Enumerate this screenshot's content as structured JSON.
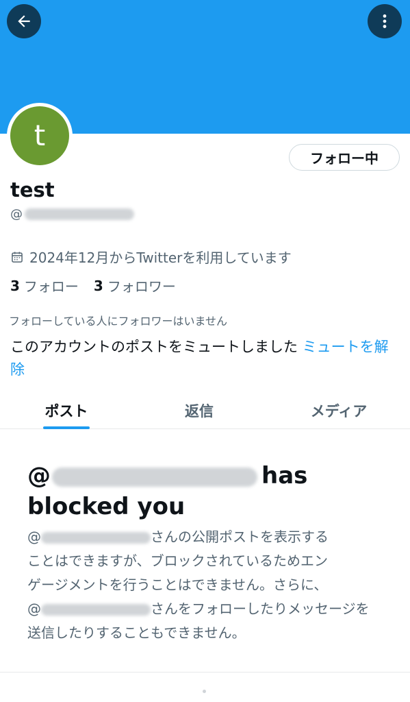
{
  "header": {
    "banner_color": "#1d9bf0",
    "back_icon": "arrow-left-icon",
    "more_icon": "more-vertical-icon"
  },
  "profile": {
    "avatar_letter": "t",
    "avatar_color": "#6a9a31",
    "display_name": "test",
    "handle_prefix": "@",
    "follow_button_label": "フォロー中",
    "joined_text": "2024年12月からTwitterを利用しています",
    "following_count": "3",
    "following_label": "フォロー",
    "followers_count": "3",
    "followers_label": "フォロワー",
    "no_known_followers_text": "フォローしている人にフォロワーはいません",
    "muted_text": "このアカウントのポストをミュートしました",
    "unmute_link": "ミュートを解除"
  },
  "tabs": [
    {
      "label": "ポスト",
      "active": true
    },
    {
      "label": "返信",
      "active": false
    },
    {
      "label": "メディア",
      "active": false
    }
  ],
  "blocked": {
    "title_prefix": "@",
    "title_suffix": "has blocked you",
    "line1_prefix": "@",
    "line1_suffix": "さんの公開ポストを表示する",
    "line2": "ことはできますが、ブロックされているためエン",
    "line3": "ゲージメントを行うことはできません。さらに、",
    "line4_prefix": "@",
    "line4_suffix": "さんをフォローしたりメッセージを",
    "line5": "送信したりすることもできません。"
  },
  "colors": {
    "accent": "#1d9bf0",
    "text_primary": "#0f1419",
    "text_secondary": "#536471"
  }
}
